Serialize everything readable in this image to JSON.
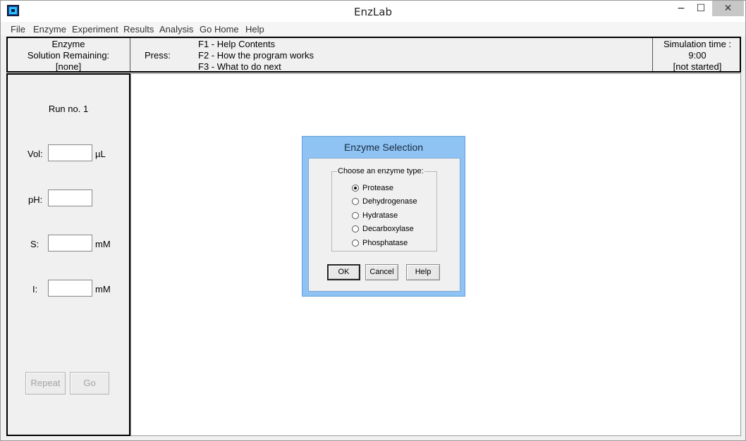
{
  "window": {
    "title": "EnzLab",
    "controls": {
      "minimize": "−",
      "maximize": "☐",
      "close": "✕"
    }
  },
  "menu": [
    "File",
    "Enzyme",
    "Experiment",
    "Results",
    "Analysis",
    "Go Home",
    "Help"
  ],
  "infobar": {
    "enzyme_lines": [
      "Enzyme",
      "Solution Remaining:",
      "[none]"
    ],
    "press_label": "Press:",
    "keys": [
      "F1 - Help Contents",
      "F2 - How the program works",
      "F3 - What to do next"
    ],
    "sim_lines": [
      "Simulation time :",
      "9:00",
      "[not started]"
    ]
  },
  "left_panel": {
    "run_label": "Run no. 1",
    "fields": [
      {
        "label": "Vol:",
        "value": "",
        "unit": "µL"
      },
      {
        "label": "pH:",
        "value": "",
        "unit": ""
      },
      {
        "label": "S:",
        "value": "",
        "unit": "mM"
      },
      {
        "label": "I:",
        "value": "",
        "unit": "mM"
      }
    ],
    "repeat_label": "Repeat",
    "go_label": "Go"
  },
  "dialog": {
    "title": "Enzyme Selection",
    "group_label": "Choose an enzyme type:",
    "options": [
      "Protease",
      "Dehydrogenase",
      "Hydratase",
      "Decarboxylase",
      "Phosphatase"
    ],
    "selected": "Protease",
    "ok_label": "OK",
    "cancel_label": "Cancel",
    "help_label": "Help"
  }
}
